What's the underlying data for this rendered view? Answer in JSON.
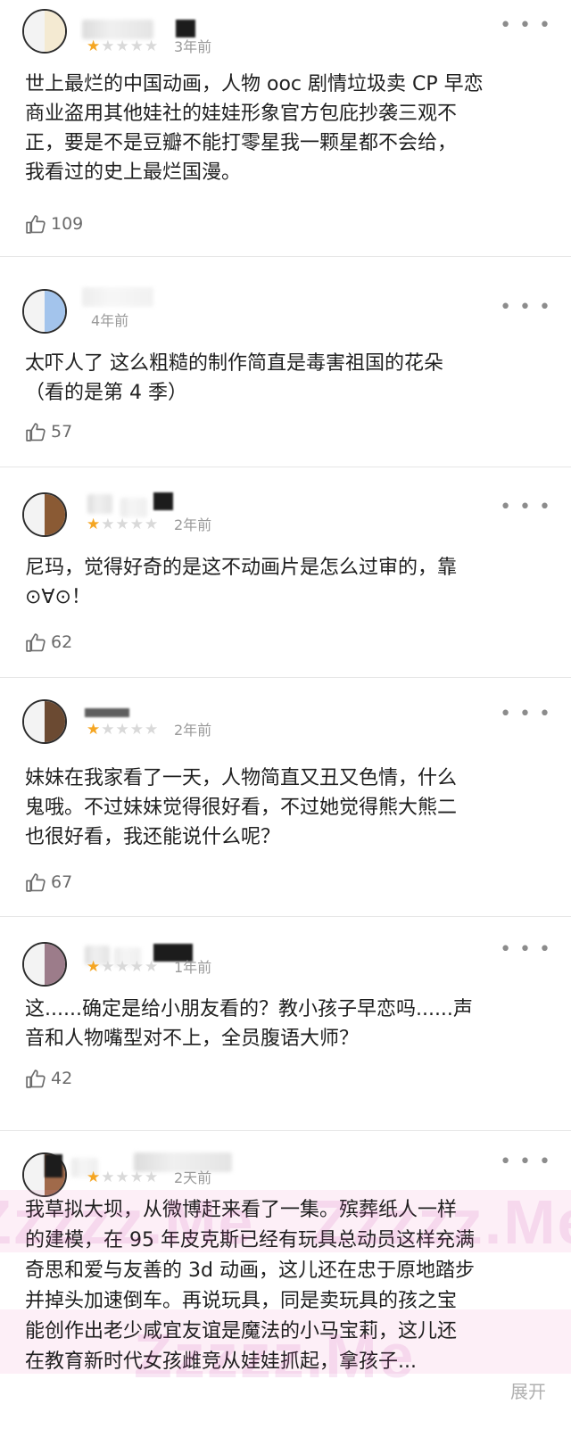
{
  "reviews": [
    {
      "time": "3年前",
      "rating": 1,
      "text_lines": [
        "世上最烂的中国动画，人物 ooc 剧情垃圾卖 CP 早恋",
        "商业盗用其他娃社的娃娃形象官方包庇抄袭三观不",
        "正，要是不是豆瓣不能打零星我一颗星都不会给，",
        "我看过的史上最烂国漫。"
      ],
      "likes": "109"
    },
    {
      "time": "4年前",
      "rating": null,
      "text_lines": [
        "太吓人了 这么粗糙的制作简直是毒害祖国的花朵",
        "（看的是第 4 季）"
      ],
      "likes": "57"
    },
    {
      "time": "2年前",
      "rating": 1,
      "text_lines": [
        "尼玛，觉得好奇的是这不动画片是怎么过审的，靠",
        "⊙∀⊙！"
      ],
      "likes": "62"
    },
    {
      "time": "2年前",
      "rating": 1,
      "text_lines": [
        "妹妹在我家看了一天，人物简直又丑又色情，什么",
        "鬼哦。不过妹妹觉得很好看，不过她觉得熊大熊二",
        "也很好看，我还能说什么呢？"
      ],
      "likes": "67"
    },
    {
      "time": "1年前",
      "rating": 1,
      "text_lines": [
        "这......确定是给小朋友看的？教小孩子早恋吗......声",
        "音和人物嘴型对不上，全员腹语大师？"
      ],
      "likes": "42"
    },
    {
      "time": "2天前",
      "rating": 1,
      "text_lines": [
        "我草拟大坝，从微博赶来看了一集。殡葬纸人一样",
        "的建模，在 95 年皮克斯已经有玩具总动员这样充满",
        "奇思和爱与友善的 3d 动画，这儿还在忠于原地踏步",
        "并掉头加速倒车。再说玩具，同是卖玩具的孩之宝",
        "能创作出老少咸宜友谊是魔法的小马宝莉，这儿还",
        "在教育新时代女孩雌竞从娃娃抓起，拿孩子..."
      ],
      "likes": null,
      "expand_label": "展开"
    }
  ],
  "watermarks": [
    "Zzzzz.Me",
    "Zzzzz.Me",
    "Zzzzz.Me"
  ],
  "colors": {
    "star_on": "#f5a623",
    "star_off": "#d9d9d9",
    "time": "#9a9a9a",
    "divider": "#e6e6e6"
  },
  "icons": {
    "like": "thumbs-up-icon",
    "more": "more-dots-icon",
    "star": "star-icon"
  }
}
